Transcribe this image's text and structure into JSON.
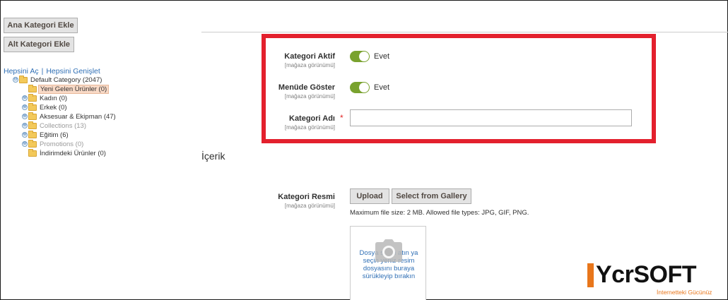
{
  "buttons": {
    "add_root_category": "Ana Kategori Ekle",
    "add_subcategory": "Alt Kategori Ekle"
  },
  "tree": {
    "collapse_all": "Hepsini Aç",
    "separator": "|",
    "expand_all": "Hepsini Genişlet",
    "nodes": [
      {
        "label": "Default Category (2047)",
        "expander": "⊖",
        "state": "normal"
      },
      {
        "label": "Yeni Gelen Ürünler (0)",
        "expander": "",
        "state": "selected"
      },
      {
        "label": "Kadın (0)",
        "expander": "⊕",
        "state": "normal"
      },
      {
        "label": "Erkek (0)",
        "expander": "⊕",
        "state": "normal"
      },
      {
        "label": "Aksesuar & Ekipman (47)",
        "expander": "⊕",
        "state": "normal"
      },
      {
        "label": "Collections (13)",
        "expander": "⊕",
        "state": "muted"
      },
      {
        "label": "Eğitim (6)",
        "expander": "⊕",
        "state": "normal"
      },
      {
        "label": "Promotions (0)",
        "expander": "⊕",
        "state": "muted"
      },
      {
        "label": "İndirimdeki Ürünler (0)",
        "expander": "",
        "state": "normal"
      }
    ]
  },
  "form": {
    "scope_label": "[mağaza görünümü]",
    "category_active": {
      "label": "Kategori Aktif",
      "value_text": "Evet",
      "enabled": true
    },
    "show_in_menu": {
      "label": "Menüde Göster",
      "value_text": "Evet",
      "enabled": true
    },
    "category_name": {
      "label": "Kategori Adı",
      "required_mark": "*",
      "value": "",
      "placeholder": ""
    }
  },
  "content_section": {
    "title": "İçerik",
    "image_label": "Kategori Resmi",
    "upload_button": "Upload",
    "gallery_button": "Select from Gallery",
    "file_note": "Maximum file size: 2 MB. Allowed file types: JPG, GIF, PNG.",
    "dropzone_text": "Dosya seçin atın ya seçin yeniz resim dosyasını buraya sürükleyip bırakın"
  },
  "watermark": {
    "brand": "YcrSOFT",
    "tagline": "İnternetteki Gücünüz"
  },
  "colors": {
    "highlight_frame": "#e3202d",
    "toggle_on": "#79a22e",
    "link": "#2f6fb5",
    "brand_accent": "#e8761b"
  }
}
